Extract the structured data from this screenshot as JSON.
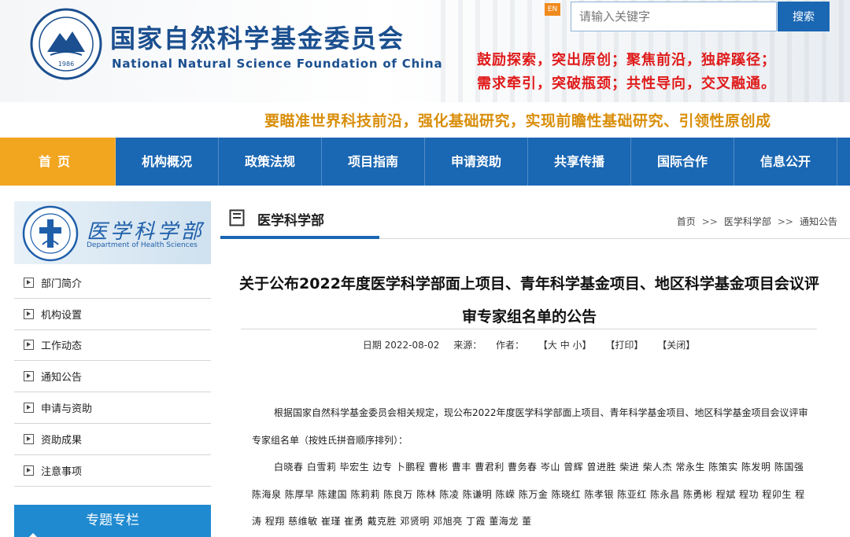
{
  "header": {
    "title_cn": "国家自然科学基金委员会",
    "title_en": "National Natural Science Foundation of China",
    "logo_year": "1986",
    "en_badge": "EN",
    "search_placeholder": "请输入关键字",
    "search_button": "搜索",
    "slogan_line1": "鼓励探索，突出原创；聚焦前沿，独辟蹊径；",
    "slogan_line2": "需求牵引，突破瓶颈；共性导向，交叉融通。",
    "tagline": "要瞄准世界科技前沿，强化基础研究，实现前瞻性基础研究、引领性原创成"
  },
  "nav": {
    "items": [
      {
        "label": "首页"
      },
      {
        "label": "机构概况"
      },
      {
        "label": "政策法规"
      },
      {
        "label": "项目指南"
      },
      {
        "label": "申请资助"
      },
      {
        "label": "共享传播"
      },
      {
        "label": "国际合作"
      },
      {
        "label": "信息公开"
      }
    ]
  },
  "sidebar": {
    "dept_name_cn": "医学科学部",
    "dept_name_en": "Department of Health Sciences",
    "items": [
      {
        "label": "部门简介"
      },
      {
        "label": "机构设置"
      },
      {
        "label": "工作动态"
      },
      {
        "label": "通知公告"
      },
      {
        "label": "申请与资助"
      },
      {
        "label": "资助成果"
      },
      {
        "label": "注意事项"
      }
    ],
    "special_column": "专题专栏"
  },
  "main": {
    "section_title": "医学科学部",
    "breadcrumb": [
      "首页",
      "医学科学部",
      "通知公告"
    ],
    "breadcrumb_sep": ">>",
    "article": {
      "title": "关于公布2022年度医学科学部面上项目、青年科学基金项目、地区科学基金项目会议评审专家组名单的公告",
      "date_label": "日期 2022-08-02",
      "source_label": "来源：",
      "author_label": "作者：",
      "font_size_label": "【大 中 小】",
      "print_label": "【打印】",
      "close_label": "【关闭】",
      "intro": "根据国家自然科学基金委员会相关规定，现公布2022年度医学科学部面上项目、青年科学基金项目、地区科学基金项目会议评审专家组名单（按姓氏拼音顺序排列）：",
      "names": "白晓春  白雪莉  毕宏生  边专  卜鹏程  曹彬  曹丰  曹君利  曹务春  岑山  曾辉  曾进胜  柴进  柴人杰  常永生  陈策实  陈发明  陈国强  陈海泉  陈厚早  陈建国  陈莉莉  陈良万  陈林  陈凌  陈谦明  陈嵘  陈万金  陈晓红  陈孝银  陈亚红  陈永昌  陈勇彬  程斌  程功  程卯生  程涛  程翔  慈维敏  崔瑾  崔勇  戴克胜  邓贤明  邓旭亮  丁霞  董海龙  董"
    }
  },
  "colors": {
    "nav_bg": "#1a67b3",
    "nav_active": "#f2a51f",
    "title_blue": "#1b4f8f",
    "slogan_red": "#e01b1b",
    "tagline_gold": "#d98e0b"
  }
}
